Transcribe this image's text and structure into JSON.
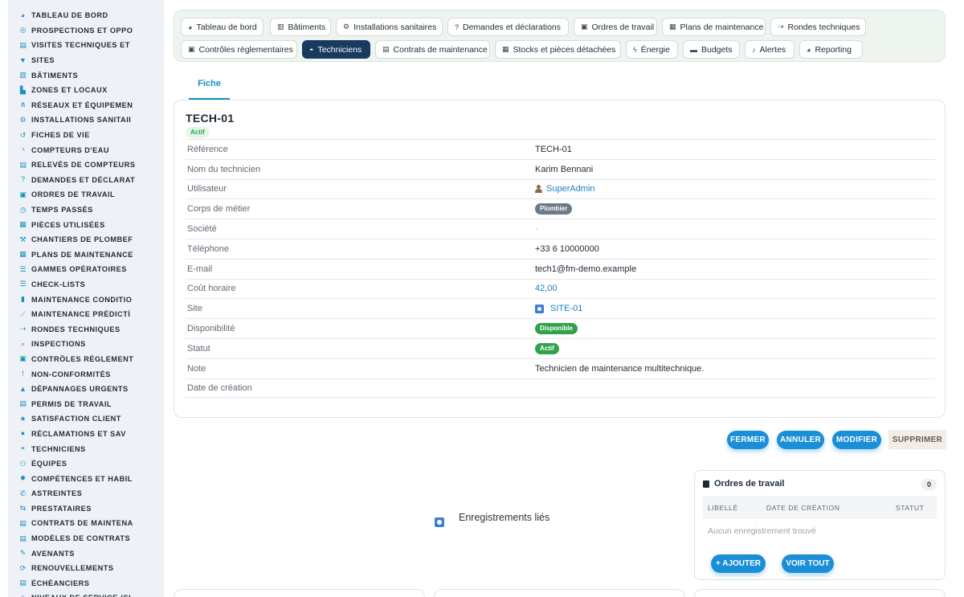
{
  "sidebar": {
    "items": [
      {
        "label": "TABLEAU DE BORD",
        "icon": "dashboard-icon",
        "glyph": "◕"
      },
      {
        "label": "PROSPECTIONS ET OPPO",
        "icon": "target-icon",
        "glyph": "◎"
      },
      {
        "label": "VISITES TECHNIQUES ET",
        "icon": "clipboard-icon",
        "glyph": "▤"
      },
      {
        "label": "SITES",
        "icon": "pin-icon",
        "glyph": "▼"
      },
      {
        "label": "BÂTIMENTS",
        "icon": "building-icon",
        "glyph": "▥"
      },
      {
        "label": "ZONES ET LOCAUX",
        "icon": "door-icon",
        "glyph": "▙"
      },
      {
        "label": "RÉSEAUX ET ÉQUIPEMEN",
        "icon": "network-icon",
        "glyph": "⋔"
      },
      {
        "label": "INSTALLATIONS SANITAII",
        "icon": "gears-icon",
        "glyph": "⚙"
      },
      {
        "label": "FICHES DE VIE",
        "icon": "history-icon",
        "glyph": "↺"
      },
      {
        "label": "COMPTEURS D'EAU",
        "icon": "gauge-icon",
        "glyph": "◔"
      },
      {
        "label": "RELEVÉS DE COMPTEURS",
        "icon": "list-icon",
        "glyph": "▤"
      },
      {
        "label": "DEMANDES ET DÉCLARAT",
        "icon": "question-icon",
        "glyph": "?"
      },
      {
        "label": "ORDRES DE TRAVAIL",
        "icon": "clipboard-check-icon",
        "glyph": "▣"
      },
      {
        "label": "TEMPS PASSÉS",
        "icon": "clock-icon",
        "glyph": "◷"
      },
      {
        "label": "PIÈCES UTILISÉES",
        "icon": "boxes-icon",
        "glyph": "▦"
      },
      {
        "label": "CHANTIERS DE PLOMBEF",
        "icon": "hammer-icon",
        "glyph": "⚒"
      },
      {
        "label": "PLANS DE MAINTENANCE",
        "icon": "calendar-icon",
        "glyph": "▦"
      },
      {
        "label": "GAMMES OPÉRATOIRES",
        "icon": "list-icon",
        "glyph": "☰"
      },
      {
        "label": "CHECK-LISTS",
        "icon": "checklist-icon",
        "glyph": "☰"
      },
      {
        "label": "MAINTENANCE CONDITIO",
        "icon": "thermometer-icon",
        "glyph": "▮"
      },
      {
        "label": "MAINTENANCE PRÉDICTİ",
        "icon": "chart-line-icon",
        "glyph": "⟋"
      },
      {
        "label": "RONDES TECHNIQUES",
        "icon": "route-icon",
        "glyph": "⇢"
      },
      {
        "label": "INSPECTIONS",
        "icon": "search-icon",
        "glyph": "⌕"
      },
      {
        "label": "CONTRÔLES RÉGLEMENT",
        "icon": "clipboard-icon",
        "glyph": "▣"
      },
      {
        "label": "NON-CONFORMITÉS",
        "icon": "alert-circle-icon",
        "glyph": "!"
      },
      {
        "label": "DÉPANNAGES URGENTS",
        "icon": "warning-icon",
        "glyph": "▲"
      },
      {
        "label": "PERMIS DE TRAVAIL",
        "icon": "file-icon",
        "glyph": "▤"
      },
      {
        "label": "SATISFACTION CLIENT",
        "icon": "star-icon",
        "glyph": "★"
      },
      {
        "label": "RÉCLAMATIONS ET SAV",
        "icon": "comment-icon",
        "glyph": "●"
      },
      {
        "label": "TECHNICIENS",
        "icon": "hard-hat-icon",
        "glyph": "◓"
      },
      {
        "label": "ÉQUIPES",
        "icon": "users-icon",
        "glyph": "⚇"
      },
      {
        "label": "COMPÉTENCES ET HABIL",
        "icon": "certificate-icon",
        "glyph": "✹"
      },
      {
        "label": "ASTREINTES",
        "icon": "phone-icon",
        "glyph": "✆"
      },
      {
        "label": "PRESTATAIRES",
        "icon": "handshake-icon",
        "glyph": "⇆"
      },
      {
        "label": "CONTRATS DE MAINTENA",
        "icon": "file-contract-icon",
        "glyph": "▤"
      },
      {
        "label": "MODÈLES DE CONTRATS",
        "icon": "file-copy-icon",
        "glyph": "▤"
      },
      {
        "label": "AVENANTS",
        "icon": "file-pen-icon",
        "glyph": "✎"
      },
      {
        "label": "RENOUVELLEMENTS",
        "icon": "refresh-icon",
        "glyph": "⟳"
      },
      {
        "label": "ÉCHÉANCIERS",
        "icon": "file-invoice-icon",
        "glyph": "▤"
      },
      {
        "label": "NIVEAUX DE SERVICE (SI",
        "icon": "shield-icon",
        "glyph": "◈"
      }
    ]
  },
  "tabs": [
    {
      "label": "Tableau de bord",
      "icon": "dashboard-icon",
      "glyph": "◕"
    },
    {
      "label": "Bâtiments",
      "icon": "building-icon",
      "glyph": "▥"
    },
    {
      "label": "Installations sanitaires",
      "icon": "gears-icon",
      "glyph": "⚙"
    },
    {
      "label": "Demandes et déclarations",
      "icon": "question-icon",
      "glyph": "?"
    },
    {
      "label": "Ordres de travail",
      "icon": "clipboard-check-icon",
      "glyph": "▣"
    },
    {
      "label": "Plans de maintenance",
      "icon": "calendar-icon",
      "glyph": "▦"
    },
    {
      "label": "Rondes techniques",
      "icon": "route-icon",
      "glyph": "⇢"
    },
    {
      "label": "Contrôles réglementaires",
      "icon": "clipboard-icon",
      "glyph": "▣"
    },
    {
      "label": "Techniciens",
      "icon": "hard-hat-icon",
      "glyph": "◓",
      "active": true
    },
    {
      "label": "Contrats de maintenance",
      "icon": "file-contract-icon",
      "glyph": "▤"
    },
    {
      "label": "Stocks et pièces détachées",
      "icon": "boxes-icon",
      "glyph": "▦"
    },
    {
      "label": "Énergie",
      "icon": "bolt-icon",
      "glyph": "ϟ"
    },
    {
      "label": "Budgets",
      "icon": "money-icon",
      "glyph": "▬"
    },
    {
      "label": "Alertes",
      "icon": "bell-icon",
      "glyph": "♪"
    },
    {
      "label": "Reporting",
      "icon": "pie-chart-icon",
      "glyph": "◕"
    }
  ],
  "fiche_tab": "Fiche",
  "record": {
    "title": "TECH-01",
    "status_badge": "Actif",
    "fields": {
      "reference": {
        "label": "Référence",
        "value": "TECH-01"
      },
      "name": {
        "label": "Nom du technicien",
        "value": "Karim Bennani"
      },
      "user": {
        "label": "Utilisateur",
        "value": "SuperAdmin"
      },
      "trade": {
        "label": "Corps de métier",
        "value": "Plombier"
      },
      "company": {
        "label": "Société",
        "value": "-"
      },
      "phone": {
        "label": "Téléphone",
        "value": "+33 6 10000000"
      },
      "email": {
        "label": "E-mail",
        "value": "tech1@fm-demo.example"
      },
      "rate": {
        "label": "Coût horaire",
        "value": "42,00"
      },
      "site": {
        "label": "Site",
        "value": "SITE-01"
      },
      "availability": {
        "label": "Disponibilité",
        "value": "Disponible"
      },
      "status": {
        "label": "Statut",
        "value": "Actif"
      },
      "note": {
        "label": "Note",
        "value": "Technicien de maintenance multitechnique."
      },
      "created": {
        "label": "Date de création",
        "value": ""
      }
    }
  },
  "actions": {
    "close": "FERMER",
    "cancel": "ANNULER",
    "edit": "MODIFIER",
    "delete": "SUPPRIMER"
  },
  "related": {
    "title": "Enregistrements liés",
    "work_orders": {
      "title": "Ordres de travail",
      "count": "0",
      "columns": [
        "LIBELLÉ",
        "DATE DE CRÉATION",
        "STATUT"
      ],
      "empty": "Aucun enregistrement trouvé",
      "add": "+ AJOUTER",
      "view_all": "VOIR TOUT"
    }
  },
  "colors": {
    "accent": "#1a8fd8",
    "active_tab": "#173a5e",
    "success": "#31a24c",
    "muted_badge": "#6c7a89"
  }
}
